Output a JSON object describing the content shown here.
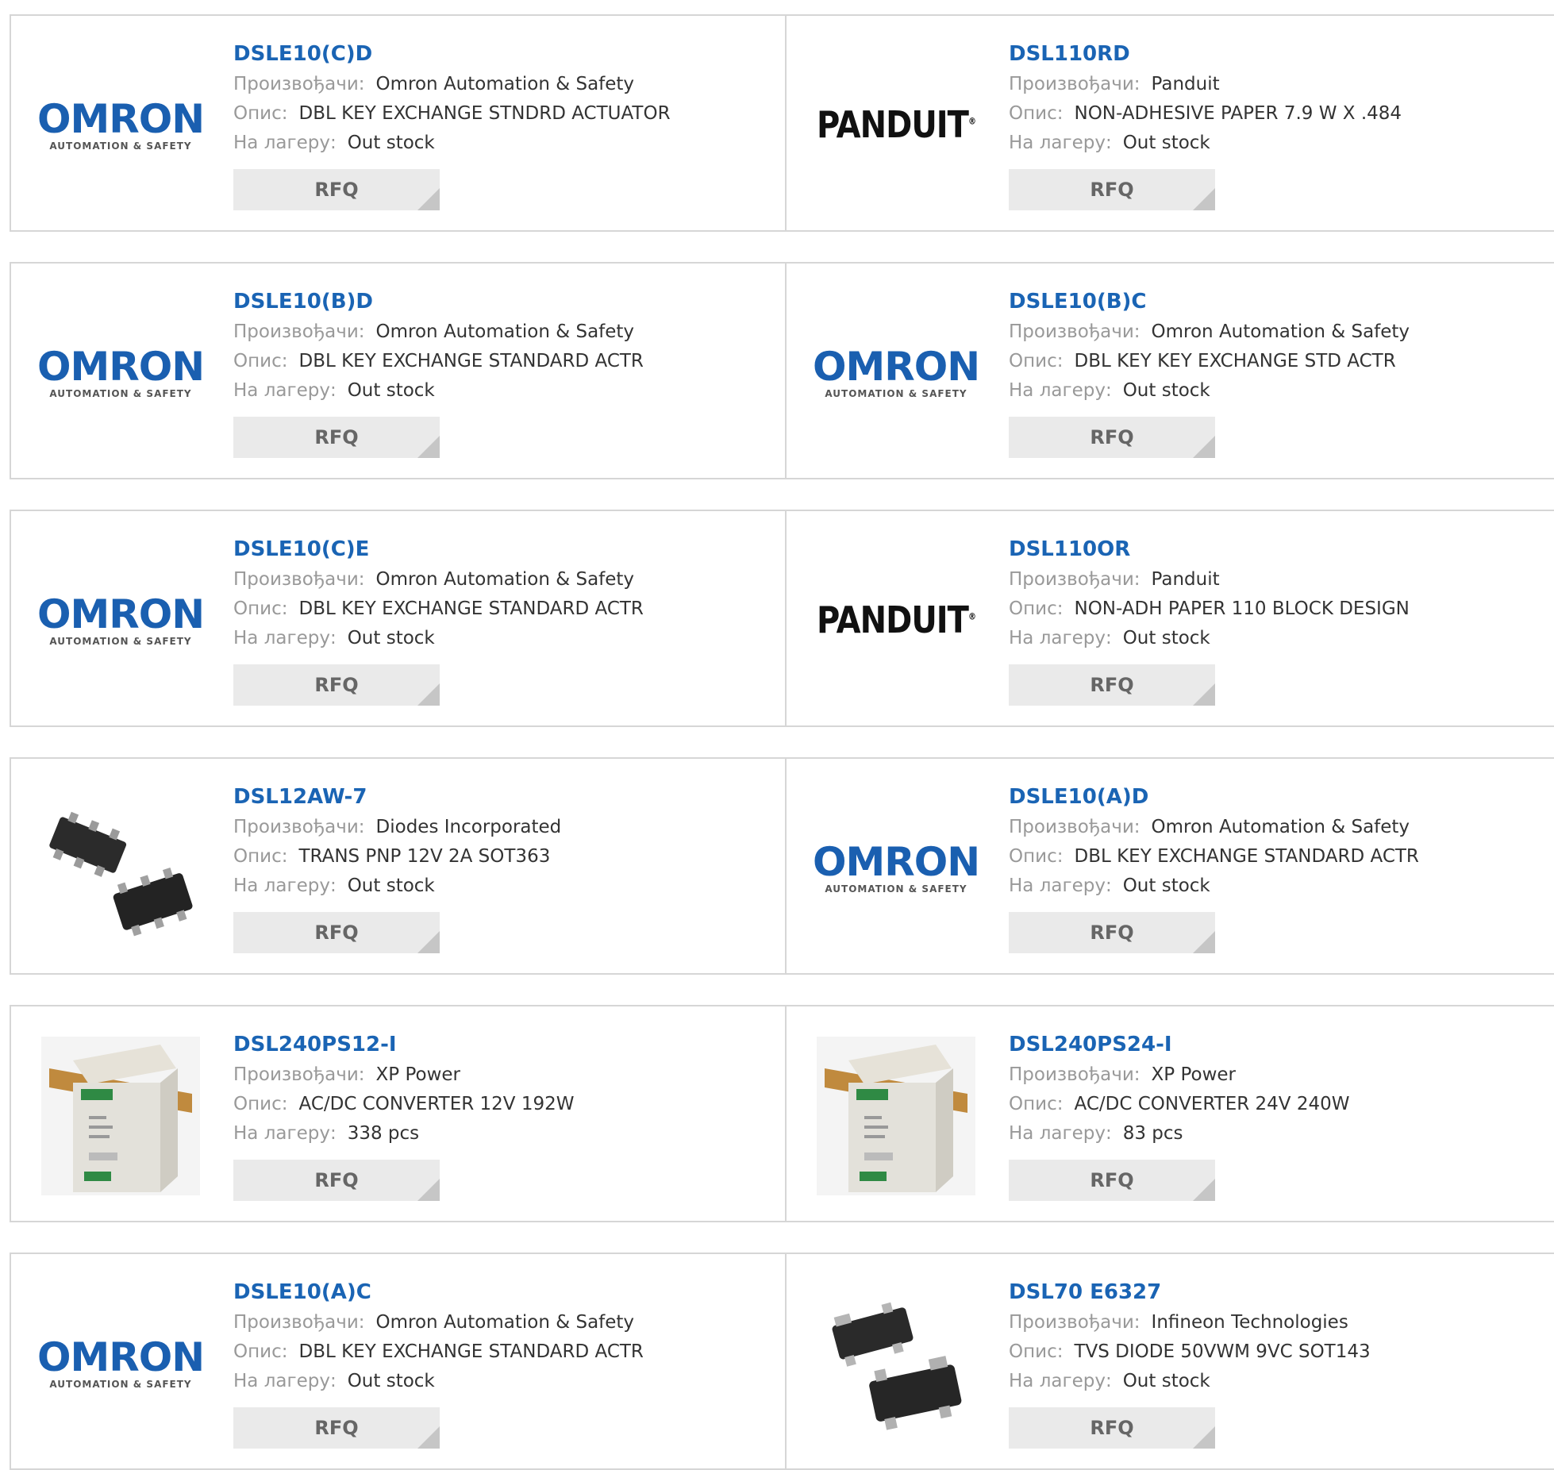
{
  "labels": {
    "manufacturer": "Произвођачи:",
    "description": "Опис:",
    "stock": "На лагеру:",
    "rfq": "RFQ"
  },
  "products": [
    {
      "part": "DSLE10(C)D",
      "manufacturer": "Omron Automation & Safety",
      "description": "DBL KEY EXCHANGE STNDRD ACTUATOR",
      "stock": "Out stock",
      "image": "omron-logo"
    },
    {
      "part": "DSL110RD",
      "manufacturer": "Panduit",
      "description": "NON-ADHESIVE PAPER 7.9 W X .484",
      "stock": "Out stock",
      "image": "panduit-logo"
    },
    {
      "part": "DSLE10(B)D",
      "manufacturer": "Omron Automation & Safety",
      "description": "DBL KEY EXCHANGE STANDARD ACTR",
      "stock": "Out stock",
      "image": "omron-logo"
    },
    {
      "part": "DSLE10(B)C",
      "manufacturer": "Omron Automation & Safety",
      "description": "DBL KEY KEY EXCHANGE STD ACTR",
      "stock": "Out stock",
      "image": "omron-logo"
    },
    {
      "part": "DSLE10(C)E",
      "manufacturer": "Omron Automation & Safety",
      "description": "DBL KEY EXCHANGE STANDARD ACTR",
      "stock": "Out stock",
      "image": "omron-logo"
    },
    {
      "part": "DSL110OR",
      "manufacturer": "Panduit",
      "description": "NON-ADH PAPER 110 BLOCK DESIGN",
      "stock": "Out stock",
      "image": "panduit-logo"
    },
    {
      "part": "DSL12AW-7",
      "manufacturer": "Diodes Incorporated",
      "description": "TRANS PNP 12V 2A SOT363",
      "stock": "Out stock",
      "image": "sot363-photo"
    },
    {
      "part": "DSLE10(A)D",
      "manufacturer": "Omron Automation & Safety",
      "description": "DBL KEY EXCHANGE STANDARD ACTR",
      "stock": "Out stock",
      "image": "omron-logo"
    },
    {
      "part": "DSL240PS12-I",
      "manufacturer": "XP Power",
      "description": "AC/DC CONVERTER 12V 192W",
      "stock": "338 pcs",
      "image": "psu-photo"
    },
    {
      "part": "DSL240PS24-I",
      "manufacturer": "XP Power",
      "description": "AC/DC CONVERTER 24V 240W",
      "stock": "83 pcs",
      "image": "psu-photo"
    },
    {
      "part": "DSLE10(A)C",
      "manufacturer": "Omron Automation & Safety",
      "description": "DBL KEY EXCHANGE STANDARD ACTR",
      "stock": "Out stock",
      "image": "omron-logo"
    },
    {
      "part": "DSL70 E6327",
      "manufacturer": "Infineon Technologies",
      "description": "TVS DIODE 50VWM 9VC SOT143",
      "stock": "Out stock",
      "image": "sot143-photo"
    }
  ],
  "logos": {
    "omron_word": "OMRON",
    "omron_sub": "AUTOMATION & SAFETY",
    "panduit_word": "PANDUIT"
  },
  "colors": {
    "link": "#1a64b4",
    "label": "#999999",
    "rfq_bg": "#eaeaea",
    "border": "#d6d6d6",
    "omron": "#1a5fb0"
  }
}
